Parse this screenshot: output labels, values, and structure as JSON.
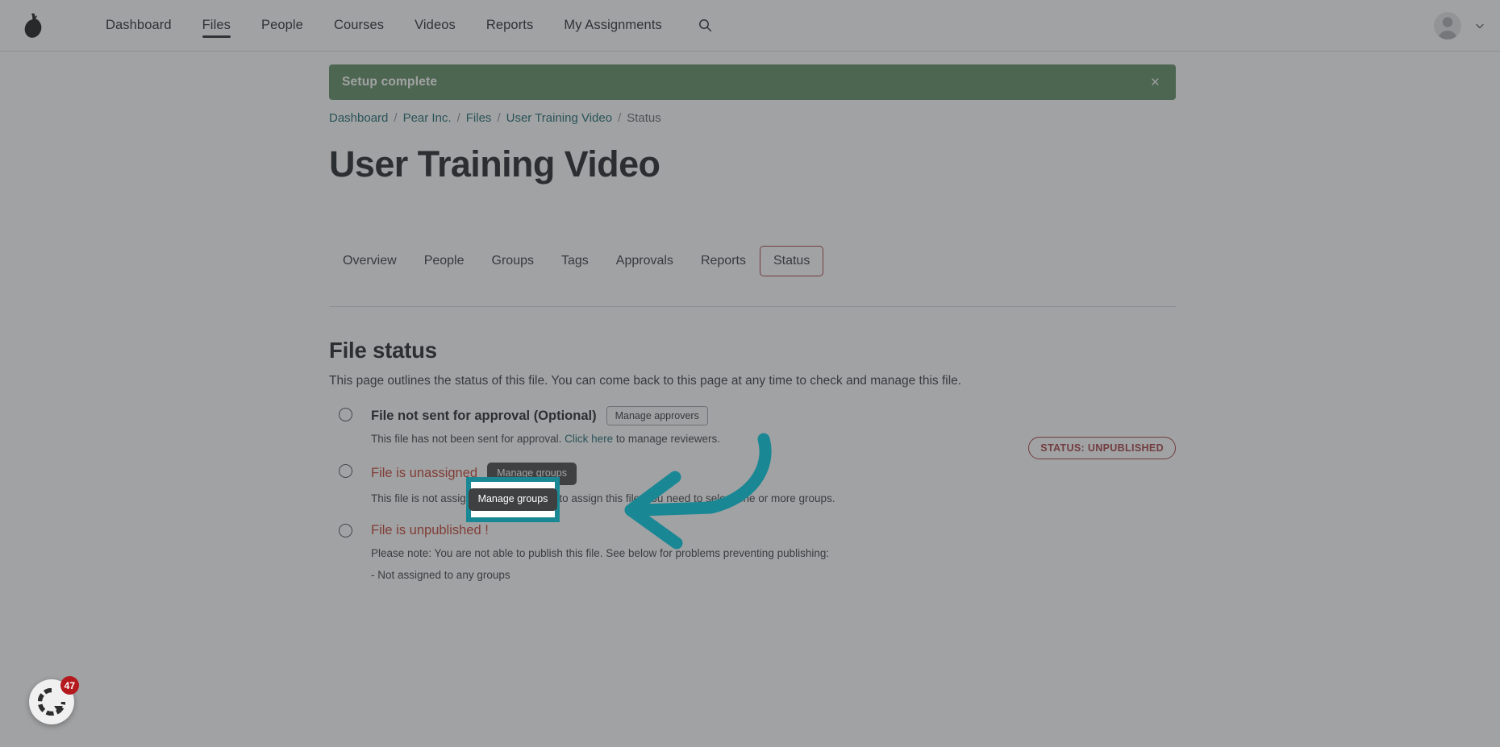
{
  "header": {
    "logo_icon": "pear-logo-icon",
    "nav_items": [
      {
        "label": "Dashboard",
        "active": false
      },
      {
        "label": "Files",
        "active": true
      },
      {
        "label": "People",
        "active": false
      },
      {
        "label": "Courses",
        "active": false
      },
      {
        "label": "Videos",
        "active": false
      },
      {
        "label": "Reports",
        "active": false
      },
      {
        "label": "My Assignments",
        "active": false
      }
    ],
    "search_icon": "search-icon",
    "avatar_icon": "user-avatar-icon",
    "chevron_icon": "chevron-down-icon"
  },
  "alert": {
    "message": "Setup complete",
    "close_label": "×",
    "background": "#5a8a5e"
  },
  "breadcrumb": [
    {
      "label": "Dashboard",
      "current": false
    },
    {
      "label": "Pear Inc.",
      "current": false
    },
    {
      "label": "Files",
      "current": false
    },
    {
      "label": "User Training Video",
      "current": false
    },
    {
      "label": "Status",
      "current": true
    }
  ],
  "breadcrumb_separator": "/",
  "page": {
    "title": "User Training Video"
  },
  "tabs": [
    {
      "label": "Overview",
      "active": false
    },
    {
      "label": "People",
      "active": false
    },
    {
      "label": "Groups",
      "active": false
    },
    {
      "label": "Tags",
      "active": false
    },
    {
      "label": "Approvals",
      "active": false
    },
    {
      "label": "Reports",
      "active": false
    },
    {
      "label": "Status",
      "active": true
    }
  ],
  "status_badge": {
    "label": "STATUS: UNPUBLISHED",
    "color": "#a4393f"
  },
  "section": {
    "title": "File status",
    "description": "This page outlines the status of this file. You can come back to this page at any time to check and manage this file."
  },
  "steps": [
    {
      "title": "File not sent for approval (Optional)",
      "danger": false,
      "button_label": "Manage approvers",
      "desc_before_link": "This file has not been sent for approval. ",
      "link_label": "Click here",
      "desc_after_link": " to manage reviewers."
    },
    {
      "title": "File is unassigned",
      "danger": true,
      "button_label": "Manage groups",
      "desc_before_link": "This file is not assigned to any groups, to assign this file, you need to select one or more groups.",
      "link_label": "",
      "desc_after_link": ""
    },
    {
      "title": "File is unpublished !",
      "danger": true,
      "button_label": "",
      "desc_before_link": "Please note: You are not able to publish this file. See below for problems preventing publishing:",
      "link_label": "",
      "desc_after_link": "",
      "extra_line": "- Not assigned to any groups"
    }
  ],
  "tour": {
    "highlight_label": "Manage groups",
    "accent_color": "#1a8795",
    "arrow_icon": "curved-arrow-left-icon"
  },
  "launcher": {
    "badge_count": "47",
    "icon": "help-widget-icon"
  }
}
